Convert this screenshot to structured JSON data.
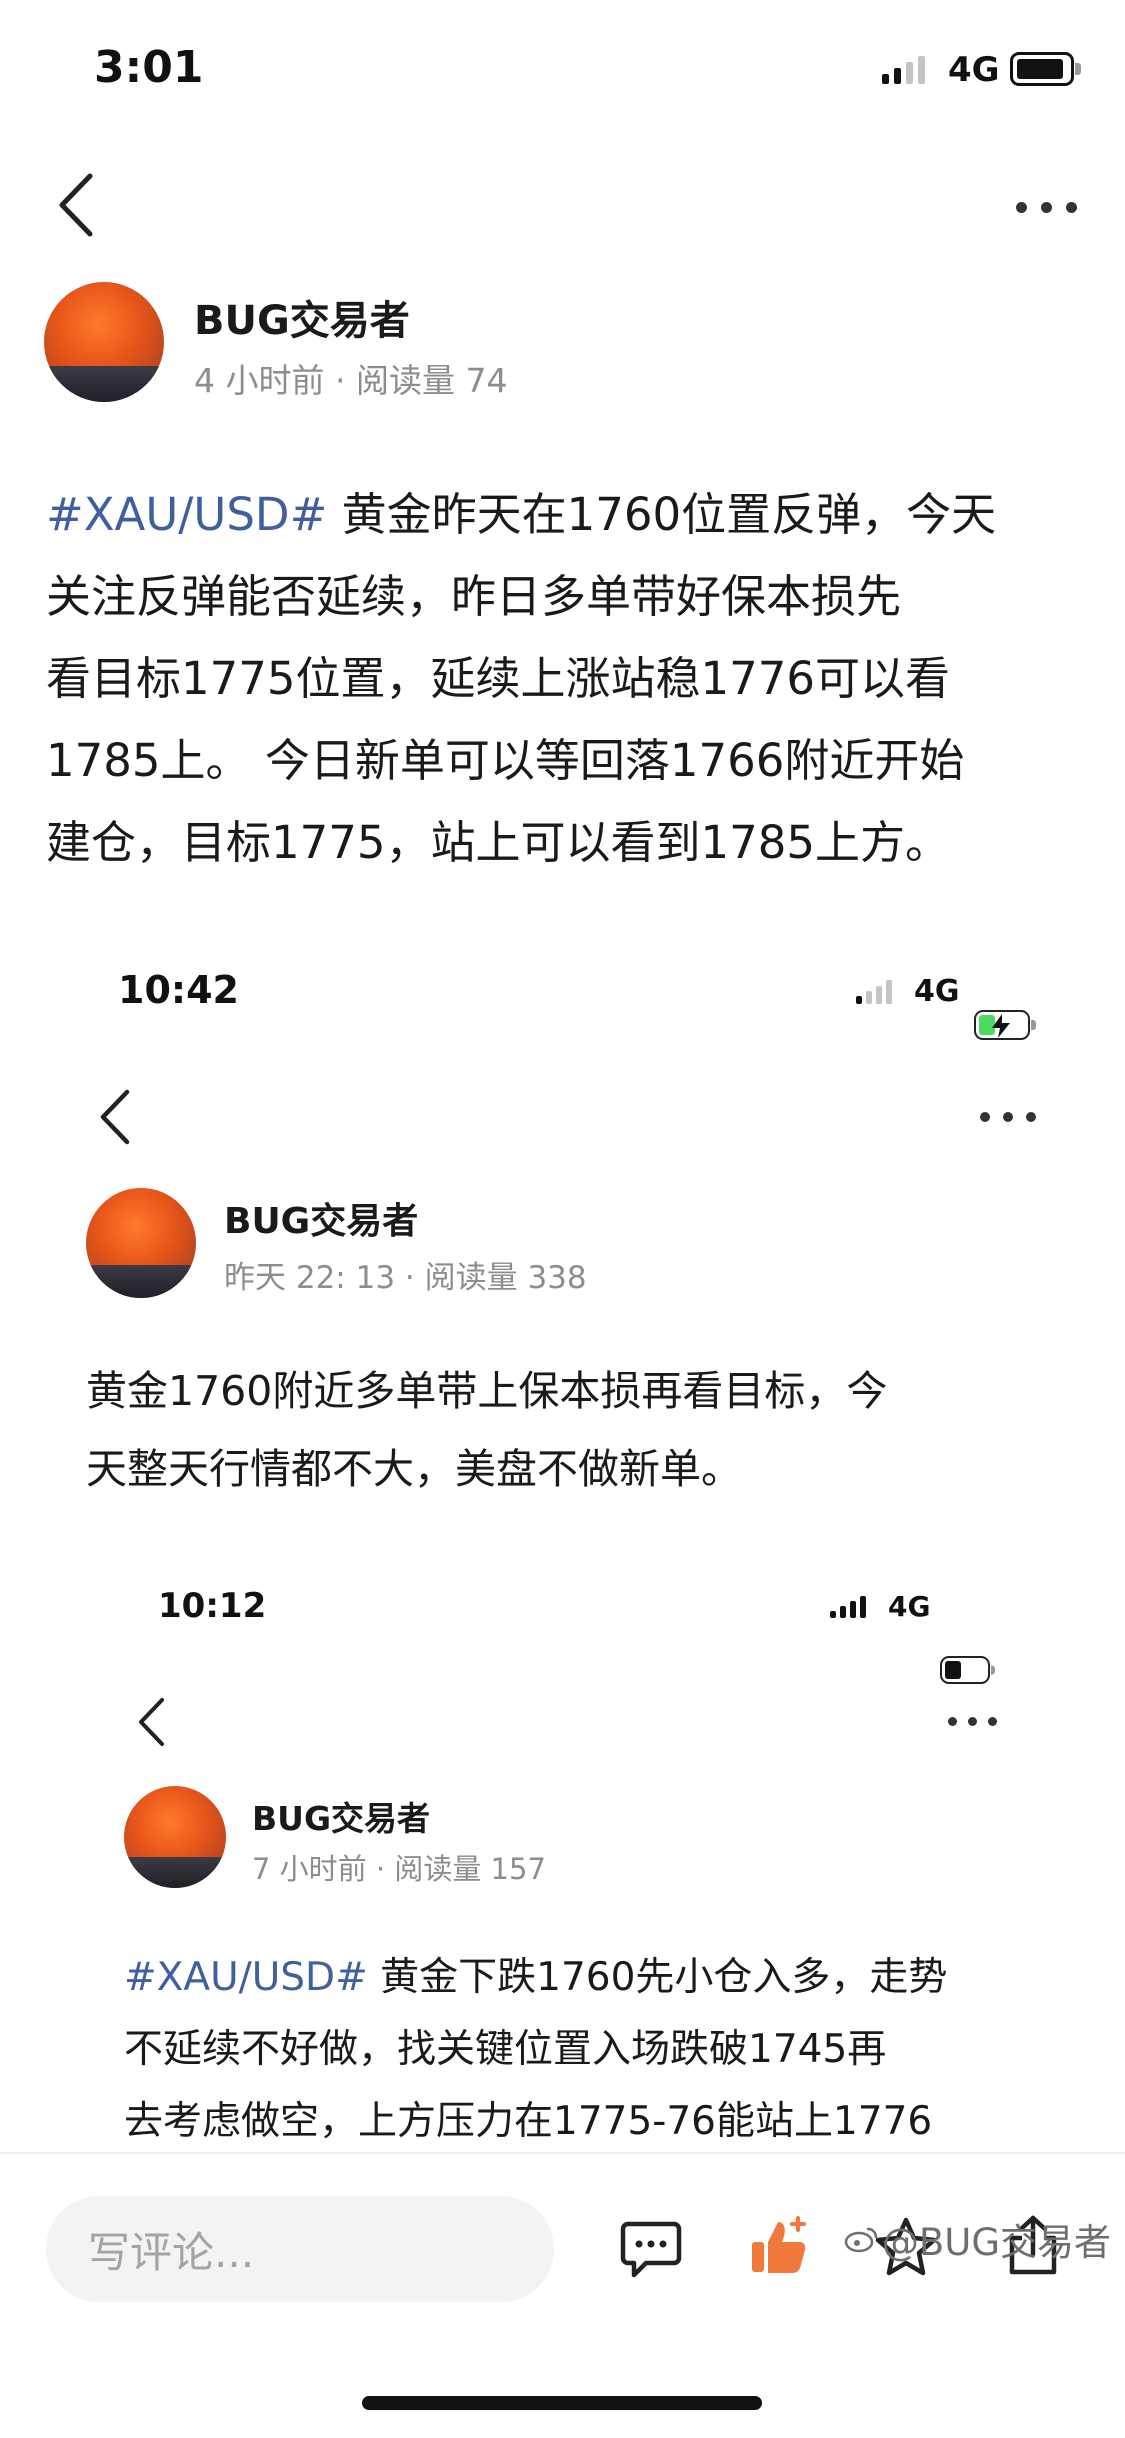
{
  "screens": [
    {
      "status": {
        "time": "3:01",
        "network": "4G"
      },
      "author": "BUG交易者",
      "meta": "4 小时前 · 阅读量 74",
      "tag": "#XAU/USD#",
      "lines": [
        " 黄金昨天在1760位置反弹，今天",
        "关注反弹能否延续，昨日多单带好保本损先",
        "看目标1775位置，延续上涨站稳1776可以看",
        "1785上。 今日新单可以等回落1766附近开始",
        "建仓，目标1775，站上可以看到1785上方。"
      ]
    },
    {
      "status": {
        "time": "10:42",
        "network": "4G"
      },
      "author": "BUG交易者",
      "meta": "昨天 22: 13 · 阅读量 338",
      "lines": [
        "黄金1760附近多单带上保本损再看目标，今",
        "天整天行情都不大，美盘不做新单。"
      ]
    },
    {
      "status": {
        "time": "10:12",
        "network": "4G"
      },
      "author": "BUG交易者",
      "meta": "7 小时前 · 阅读量 157",
      "tag": "#XAU/USD#",
      "lines": [
        " 黄金下跌1760先小仓入多，走势",
        "不延续不好做，找关键位置入场跌破1745再",
        "去考虑做空，上方压力在1775-76能站上1776"
      ]
    }
  ],
  "bottom_bar": {
    "comment_placeholder": "写评论..."
  },
  "watermark": "@BUG交易者",
  "icons": {
    "back": "chevron-left-icon",
    "more": "more-horizontal-icon",
    "comment": "chat-bubble-icon",
    "like": "thumbs-up-icon",
    "favorite": "star-icon",
    "share": "share-icon"
  },
  "colors": {
    "tag": "#3f5f9e",
    "like": "#f07a3c",
    "meta": "#8d8d8d"
  }
}
